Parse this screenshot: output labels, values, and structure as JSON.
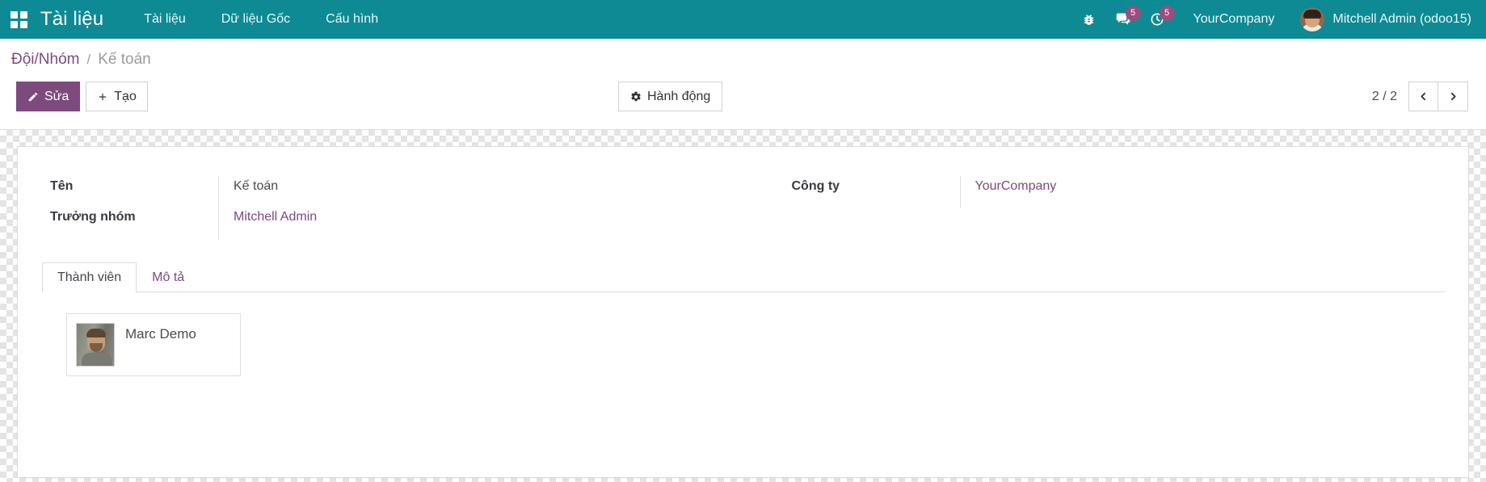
{
  "navbar": {
    "apps_icon": "apps-grid-icon",
    "brand": "Tài liệu",
    "menu_items": [
      {
        "label": "Tài liệu"
      },
      {
        "label": "Dữ liệu Gốc"
      },
      {
        "label": "Cấu hình"
      }
    ],
    "sys_icons": [
      {
        "name": "bug-icon",
        "badge": null
      },
      {
        "name": "messages-icon",
        "badge": "5"
      },
      {
        "name": "activities-clock-icon",
        "badge": "5"
      }
    ],
    "company": "YourCompany",
    "user": "Mitchell Admin (odoo15)",
    "avatar": "user-avatar"
  },
  "control_panel": {
    "breadcrumb": {
      "root": "Đội/Nhóm",
      "separator": "/",
      "current": "Kế toán"
    },
    "buttons": {
      "edit": "Sửa",
      "edit_icon": "pencil-icon",
      "create": "Tạo",
      "create_icon": "plus-icon",
      "action": "Hành động",
      "action_icon": "gear-icon"
    },
    "pager": {
      "value": "2 / 2",
      "prev_icon": "chevron-left-icon",
      "next_icon": "chevron-right-icon"
    }
  },
  "form": {
    "left_fields": [
      {
        "label": "Tên",
        "value": "Kế toán",
        "type": "text"
      },
      {
        "label": "Trưởng nhóm",
        "value": "Mitchell Admin",
        "type": "link"
      }
    ],
    "right_fields": [
      {
        "label": "Công ty",
        "value": "YourCompany",
        "type": "link"
      }
    ]
  },
  "notebook": {
    "tabs": [
      {
        "label": "Thành viên",
        "active": true
      },
      {
        "label": "Mô tả",
        "active": false
      }
    ],
    "members": [
      {
        "name": "Marc Demo",
        "photo": "marc-demo-photo"
      }
    ]
  },
  "colors": {
    "navbar_teal": "#0d8a93",
    "accent_purple": "#7d4a7e",
    "badge_purple": "#9b4d7e",
    "text_dark": "#3a3a43",
    "text_muted": "#9b9b9b"
  }
}
